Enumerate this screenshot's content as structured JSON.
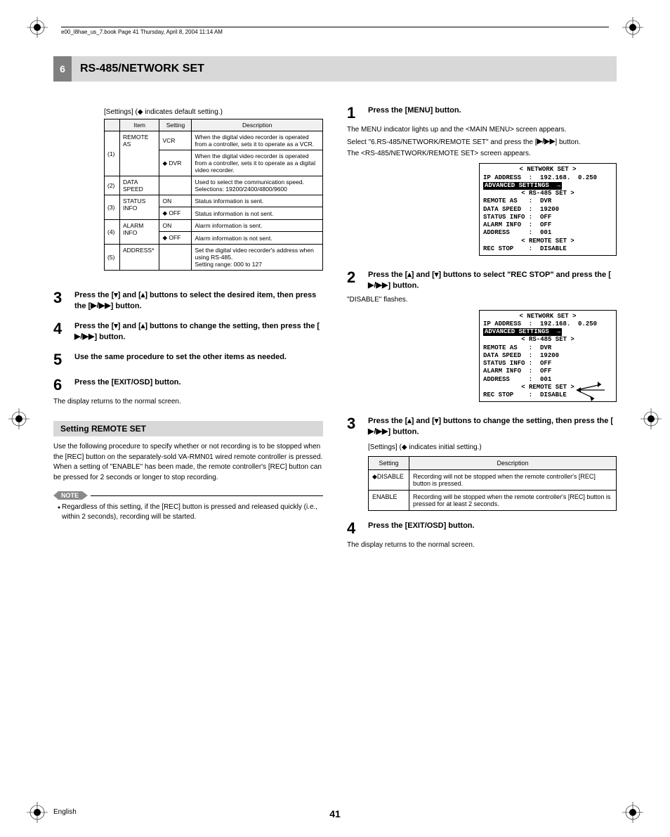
{
  "book_line": "e00_l8hae_us_7.book  Page 41  Thursday, April 8, 2004  11:14 AM",
  "chapter": {
    "num": "6",
    "title": "RS-485/NETWORK SET"
  },
  "left": {
    "settings_legend_pre": "[Settings] (",
    "settings_legend_post": " indicates default setting.)",
    "table1": {
      "headers": {
        "item": "Item",
        "setting": "Setting",
        "desc": "Description"
      },
      "rows": [
        {
          "idx": "(1)",
          "item": "REMOTE AS",
          "cells": [
            {
              "setting": "VCR",
              "default": false,
              "desc": "When the digital video recorder is operated from a controller, sets it to operate as a VCR."
            },
            {
              "setting": "DVR",
              "default": true,
              "desc": "When the digital video recorder is operated from a controller, sets it to operate as a digital video recorder."
            }
          ]
        },
        {
          "idx": "(2)",
          "item": "DATA SPEED",
          "cells": [
            {
              "setting": "",
              "default": false,
              "desc": "Used to select the communication speed. Selections: 19200/2400/4800/9600"
            }
          ]
        },
        {
          "idx": "(3)",
          "item": "STATUS INFO",
          "cells": [
            {
              "setting": "ON",
              "default": false,
              "desc": "Status information is sent."
            },
            {
              "setting": "OFF",
              "default": true,
              "desc": "Status information is not sent."
            }
          ]
        },
        {
          "idx": "(4)",
          "item": "ALARM INFO",
          "cells": [
            {
              "setting": "ON",
              "default": false,
              "desc": "Alarm information is sent."
            },
            {
              "setting": "OFF",
              "default": true,
              "desc": "Alarm information is not sent."
            }
          ]
        },
        {
          "idx": "(5)",
          "item": "ADDRESS*",
          "cells": [
            {
              "setting": "",
              "default": false,
              "desc": "Set the digital video recorder's address when using RS-485.\nSetting range: 000 to 127"
            }
          ]
        }
      ]
    },
    "step3_a": "Press the [",
    "step3_b": "] and [",
    "step3_c": "] buttons to select the desired item, then press the [",
    "step3_d": "] button.",
    "step4_a": "Press the [",
    "step4_b": "] and [",
    "step4_c": "] buttons to change the setting, then press the [",
    "step4_d": "] button.",
    "step5": "Use the same procedure to set the other items as needed.",
    "step6": "Press the [EXIT/OSD] button.",
    "after6": "The display returns to the normal screen.",
    "subhead": "Setting REMOTE SET",
    "remote_para": "Use the following procedure to specify whether or not recording is to be stopped when the [REC] button on the separately-sold VA-RMN01 wired remote controller is pressed. When a setting of \"ENABLE\" has been made, the remote controller's [REC] button can be pressed for 2 seconds or longer to stop recording.",
    "note_label": "NOTE",
    "note_bullet": "Regardless of this setting, if the [REC] button is pressed and released quickly (i.e., within 2 seconds), recording will be started."
  },
  "right": {
    "step1": "Press the [MENU] button.",
    "p1a": "The MENU indicator lights up and the <MAIN MENU> screen appears.",
    "p1b_a": "Select \"6.RS-485/NETWORK/REMOTE SET\" and press the [",
    "p1b_b": "] button.",
    "p1c": "The <RS-485/NETWORK/REMOTE SET> screen appears.",
    "osd1": {
      "l1": "< NETWORK SET >",
      "l2": "IP ADDRESS  :  192.168.  0.250",
      "l3inv": "ADVANCED SETTINGS  →",
      "l4": "< RS-485 SET >",
      "l5": "REMOTE AS   :  DVR",
      "l6": "DATA SPEED  :  19200",
      "l7": "STATUS INFO :  OFF",
      "l8": "ALARM INFO  :  OFF",
      "l9": "ADDRESS     :  001",
      "l10": "< REMOTE SET >",
      "l11": "REC STOP    :  DISABLE"
    },
    "step2_a": "Press the [",
    "step2_b": "] and [",
    "step2_c": "] buttons to select \"REC STOP\" and press the [",
    "step2_d": "] button.",
    "after2": "\"DISABLE\" flashes.",
    "step3_a": "Press the [",
    "step3_b": "] and [",
    "step3_c": "] buttons to change the setting, then press the [",
    "step3_d": "] button.",
    "settings_legend2_pre": "[Settings] (",
    "settings_legend2_post": " indicates initial setting.)",
    "table2": {
      "headers": {
        "setting": "Setting",
        "desc": "Description"
      },
      "rows": [
        {
          "setting": "DISABLE",
          "default": true,
          "desc": "Recording will not be stopped when the remote controller's [REC] button is pressed."
        },
        {
          "setting": "ENABLE",
          "default": false,
          "desc": "Recording will be stopped when the remote controller's [REC] button is pressed for at least 2 seconds."
        }
      ]
    },
    "step4": "Press the [EXIT/OSD] button.",
    "after4": "The display returns to the normal screen."
  },
  "footer": {
    "lang": "English",
    "page": "41"
  },
  "nums": {
    "n1": "1",
    "n2": "2",
    "n3": "3",
    "n4": "4",
    "n5": "5",
    "n6": "6"
  }
}
